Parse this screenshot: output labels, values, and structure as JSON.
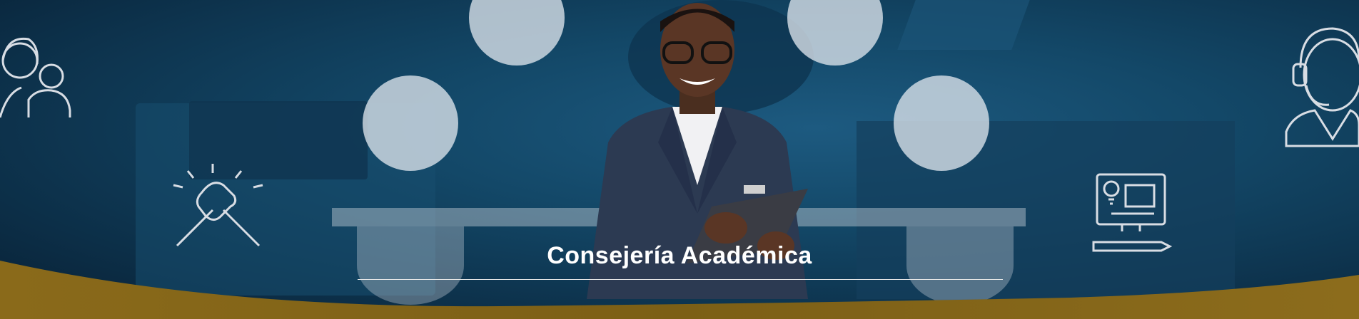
{
  "banner": {
    "title": "Consejería Académica",
    "accent_color": "#8a6a1a",
    "background_color": "#0d3550"
  },
  "icons": [
    "advisors-icon",
    "handshake-icon",
    "lightbulb-computer-icon",
    "headset-support-icon"
  ]
}
